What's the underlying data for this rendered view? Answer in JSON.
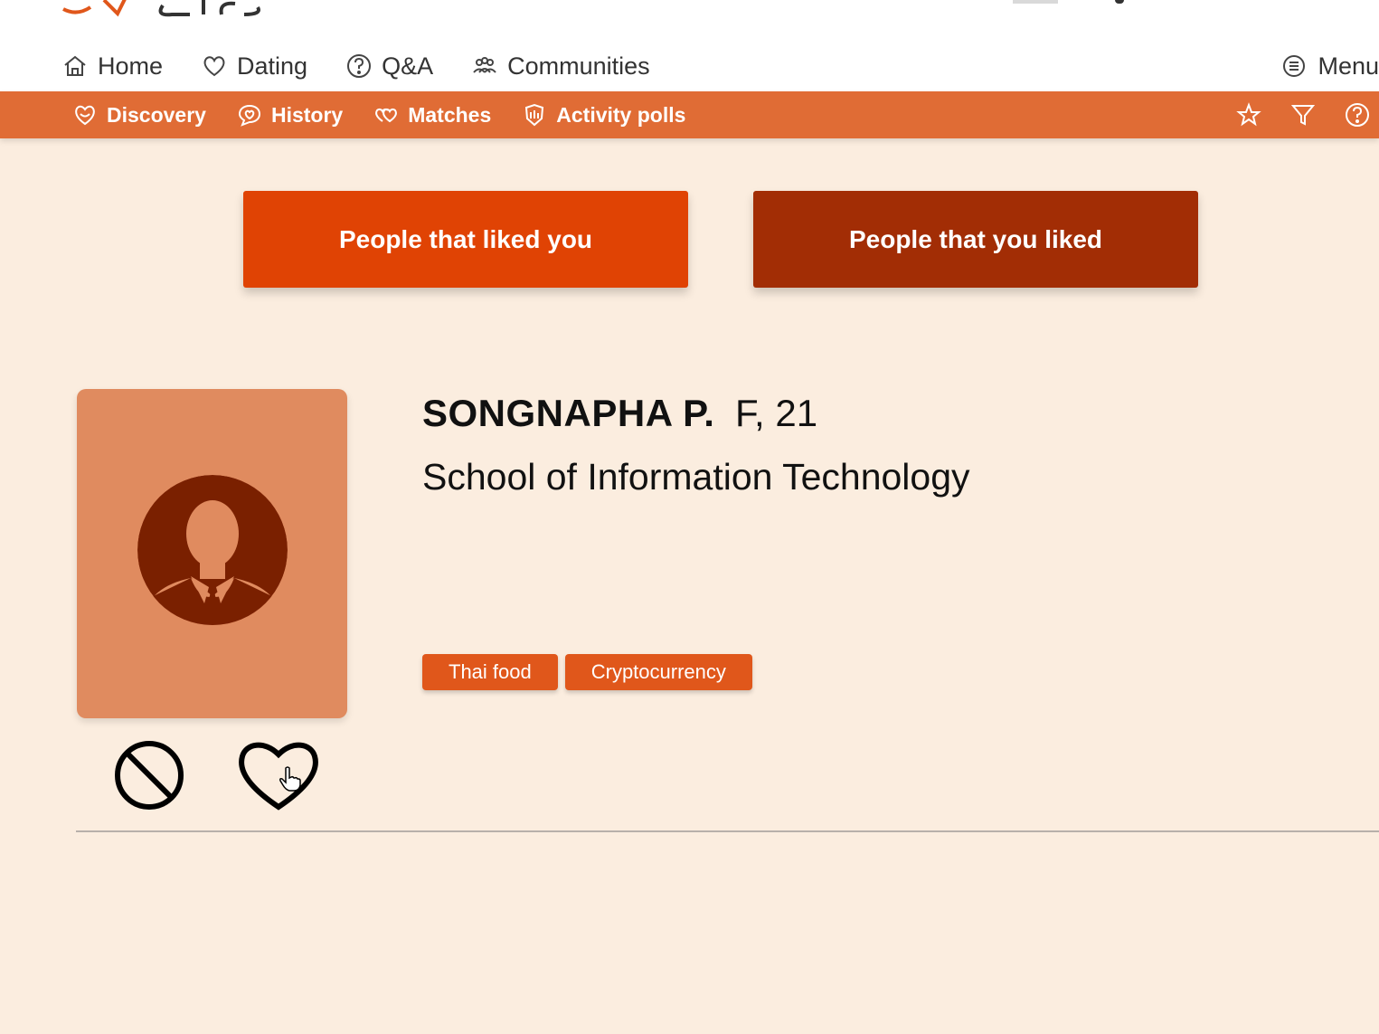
{
  "main_nav": {
    "items": [
      {
        "label": "Home",
        "icon": "home-icon"
      },
      {
        "label": "Dating",
        "icon": "heart-icon"
      },
      {
        "label": "Q&A",
        "icon": "question-icon"
      },
      {
        "label": "Communities",
        "icon": "people-icon"
      }
    ],
    "menu_label": "Menu"
  },
  "sub_nav": {
    "items": [
      {
        "label": "Discovery",
        "icon": "heart-outline-icon"
      },
      {
        "label": "History",
        "icon": "chat-heart-icon"
      },
      {
        "label": "Matches",
        "icon": "double-heart-icon"
      },
      {
        "label": "Activity polls",
        "icon": "poll-icon"
      }
    ],
    "actions": [
      "star-icon",
      "filter-icon",
      "help-icon"
    ]
  },
  "tabs": {
    "liked_you": "People that liked you",
    "you_liked": "People that you liked"
  },
  "profile": {
    "name": "SONGNAPHA P.",
    "meta": "F, 21",
    "school": "School of Information Technology",
    "tags": [
      "Thai food",
      "Cryptocurrency"
    ]
  },
  "colors": {
    "accent_orange": "#e06c35",
    "button_bright": "#e04304",
    "button_dark": "#a22d05",
    "avatar_bg": "#e08b5f",
    "page_bg": "#fbeddf"
  }
}
